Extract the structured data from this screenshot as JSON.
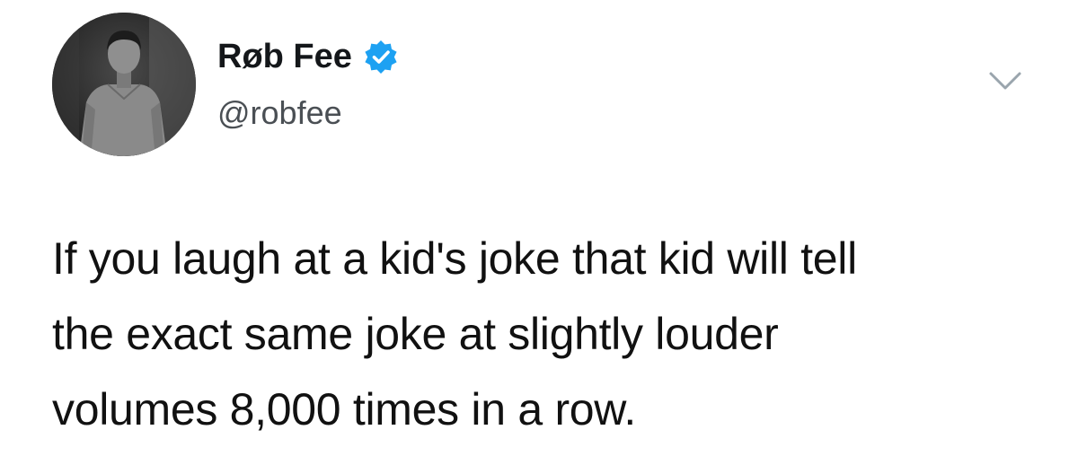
{
  "tweet": {
    "author": {
      "display_name": "Røb Fee",
      "handle": "@robfee",
      "verified": true
    },
    "text_lines": [
      "If you laugh at a kid's joke that kid will tell",
      "the exact same joke at slightly louder",
      "volumes 8,000 times in a row."
    ]
  },
  "colors": {
    "verified_badge": "#1da1f2",
    "handle_text": "#4a4f54",
    "body_text": "#111111",
    "chevron": "#9aa5ad"
  },
  "icons": {
    "verified": "verified-badge-icon",
    "menu": "chevron-down-icon"
  }
}
